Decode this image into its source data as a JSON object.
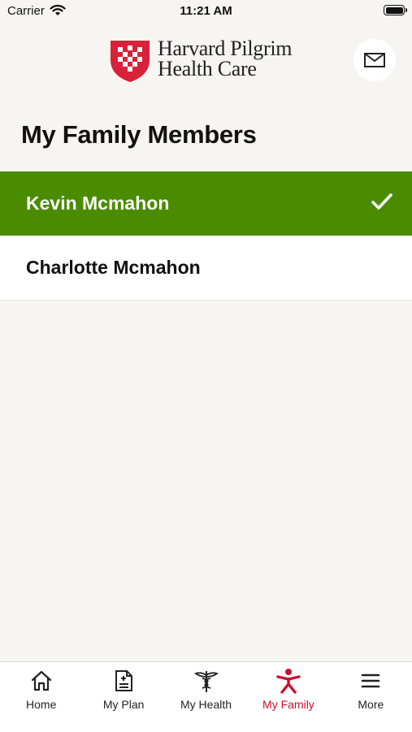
{
  "status_bar": {
    "carrier": "Carrier",
    "time": "11:21 AM"
  },
  "header": {
    "logo_line1": "Harvard Pilgrim",
    "logo_line2": "Health Care",
    "brand_color": "#d9213a"
  },
  "page": {
    "title": "My Family Members"
  },
  "members": [
    {
      "name": "Kevin Mcmahon",
      "selected": true
    },
    {
      "name": "Charlotte Mcmahon",
      "selected": false
    }
  ],
  "tabs": [
    {
      "label": "Home",
      "icon": "home-icon"
    },
    {
      "label": "My Plan",
      "icon": "document-icon"
    },
    {
      "label": "My Health",
      "icon": "caduceus-icon"
    },
    {
      "label": "My Family",
      "icon": "person-icon",
      "active": true
    },
    {
      "label": "More",
      "icon": "menu-icon"
    }
  ],
  "colors": {
    "selected_row": "#4a8b00",
    "active_tab": "#c8102e",
    "background": "#f6f5f2"
  }
}
